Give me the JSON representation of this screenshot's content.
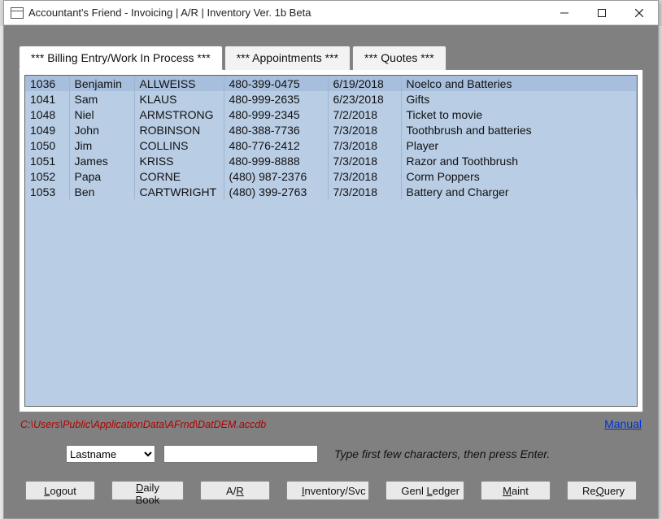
{
  "window": {
    "title": "Accountant's Friend - Invoicing | A/R | Inventory Ver. 1b Beta"
  },
  "tabs": [
    {
      "label": "*** Billing Entry/Work In Process ***",
      "active": true
    },
    {
      "label": "*** Appointments ***",
      "active": false
    },
    {
      "label": "*** Quotes ***",
      "active": false
    }
  ],
  "rows": [
    {
      "id": "1036",
      "first": "Benjamin",
      "last": "ALLWEISS",
      "phone": "480-399-0475",
      "date": "6/19/2018",
      "desc": "Noelco and Batteries",
      "selected": true
    },
    {
      "id": "1041",
      "first": "Sam",
      "last": "KLAUS",
      "phone": "480-999-2635",
      "date": "6/23/2018",
      "desc": "Gifts",
      "selected": false
    },
    {
      "id": "1048",
      "first": "Niel",
      "last": "ARMSTRONG",
      "phone": "480-999-2345",
      "date": "7/2/2018",
      "desc": "Ticket to movie",
      "selected": false
    },
    {
      "id": "1049",
      "first": "John",
      "last": "ROBINSON",
      "phone": "480-388-7736",
      "date": "7/3/2018",
      "desc": "Toothbrush and batteries",
      "selected": false
    },
    {
      "id": "1050",
      "first": "Jim",
      "last": "COLLINS",
      "phone": "480-776-2412",
      "date": "7/3/2018",
      "desc": "Player",
      "selected": false
    },
    {
      "id": "1051",
      "first": "James",
      "last": "KRISS",
      "phone": "480-999-8888",
      "date": "7/3/2018",
      "desc": "Razor and Toothbrush",
      "selected": false
    },
    {
      "id": "1052",
      "first": "Papa",
      "last": "CORNE",
      "phone": "(480) 987-2376",
      "date": "7/3/2018",
      "desc": "Corm Poppers",
      "selected": false
    },
    {
      "id": "1053",
      "first": "Ben",
      "last": "CARTWRIGHT",
      "phone": "(480) 399-2763",
      "date": "7/3/2018",
      "desc": "Battery and Charger",
      "selected": false
    }
  ],
  "status": {
    "path": "C:\\Users\\Public\\ApplicationData\\AFrnd\\DatDEM.accdb",
    "manual_label": "Manual"
  },
  "filter": {
    "field_selected": "Lastname",
    "value": "",
    "hint": "Type first few characters, then press Enter."
  },
  "buttons": {
    "logout": "Logout",
    "dailybook": "Daily Book",
    "ar": "A/R",
    "inventory": "Inventory/Svc",
    "genl": "Genl Ledger",
    "maint": "Maint",
    "requery": "ReQuery"
  }
}
